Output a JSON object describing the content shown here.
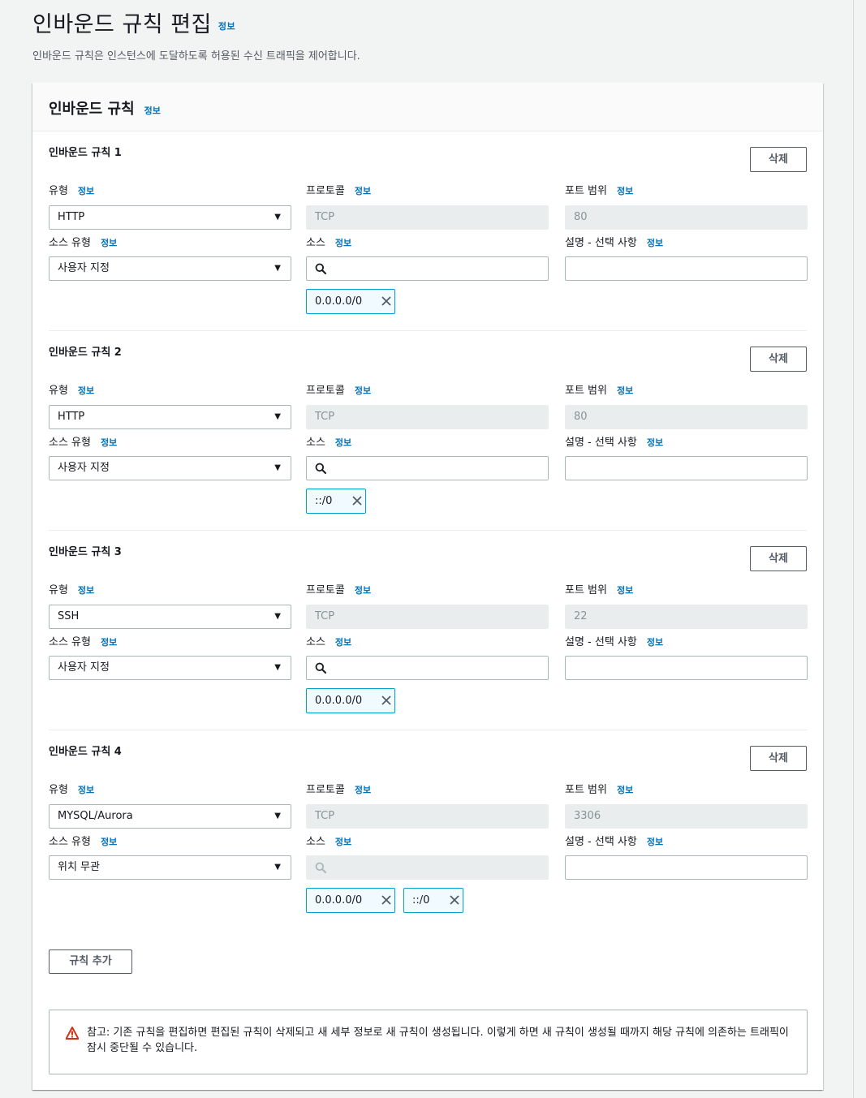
{
  "page": {
    "title": "인바운드 규칙 편집",
    "info": "정보",
    "description": "인바운드 규칙은 인스턴스에 도달하도록 허용된 수신 트래픽을 제어합니다."
  },
  "panel": {
    "title": "인바운드 규칙",
    "info": "정보"
  },
  "labels": {
    "type": "유형",
    "protocol": "프로토콜",
    "port_range": "포트 범위",
    "source_type": "소스 유형",
    "source": "소스",
    "description": "설명 - 선택 사항",
    "info": "정보",
    "delete": "삭제"
  },
  "rules": [
    {
      "heading": "인바운드 규칙 1",
      "type": "HTTP",
      "protocol": "TCP",
      "port": "80",
      "source_type": "사용자 지정",
      "tokens": [
        "0.0.0.0/0"
      ]
    },
    {
      "heading": "인바운드 규칙 2",
      "type": "HTTP",
      "protocol": "TCP",
      "port": "80",
      "source_type": "사용자 지정",
      "tokens": [
        "::/0"
      ]
    },
    {
      "heading": "인바운드 규칙 3",
      "type": "SSH",
      "protocol": "TCP",
      "port": "22",
      "source_type": "사용자 지정",
      "tokens": [
        "0.0.0.0/0"
      ]
    },
    {
      "heading": "인바운드 규칙 4",
      "type": "MYSQL/Aurora",
      "protocol": "TCP",
      "port": "3306",
      "source_type": "위치 무관",
      "tokens": [
        "0.0.0.0/0",
        "::/0"
      ]
    }
  ],
  "add_rule": "규칙 추가",
  "warning": {
    "text": "참고: 기존 규칙을 편집하면 편집된 규칙이 삭제되고 새 세부 정보로 새 규칙이 생성됩니다. 이렇게 하면 새 규칙이 생성될 때까지 해당 규칙에 의존하는 트래픽이 잠시 중단될 수 있습니다."
  },
  "colors": {
    "accent": "#0073bb",
    "token_border": "#00a1c9",
    "warning": "#d13212"
  }
}
